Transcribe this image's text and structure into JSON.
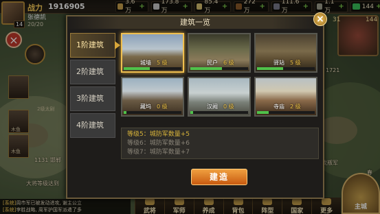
{
  "player": {
    "power_label": "战力",
    "power_value": "1916905",
    "name": "张德凯",
    "level": "14",
    "troops": "20/20"
  },
  "resources": [
    {
      "value": "3.6万",
      "icon": "gold-icon"
    },
    {
      "value": "173.8万",
      "icon": "silver-icon"
    },
    {
      "value": "85.4万",
      "icon": "food-icon"
    },
    {
      "value": "272万",
      "icon": "wood-icon"
    },
    {
      "value": "111.6万",
      "icon": "iron-icon"
    },
    {
      "value": "1.1万",
      "icon": "stone-icon"
    },
    {
      "value": "144",
      "icon": "gem-icon"
    }
  ],
  "minimap": {
    "coord_a": "31",
    "coord_b": "144"
  },
  "map_labels": [
    "1721",
    "1131 邯郸",
    "讨伐叛军",
    "大将等级达到",
    "春"
  ],
  "left_side": {
    "hero_labels": [
      "2级太尉",
      "木鱼",
      "木鱼"
    ],
    "close_label": "×"
  },
  "chat": [
    {
      "tag": "[系统]",
      "text": "周市军已被发动进攻, 谢主公立"
    },
    {
      "tag": "[系统]",
      "text": "李胜战略, 周军护国军派遣了多"
    }
  ],
  "nav": [
    "武将",
    "军师",
    "养成",
    "背包",
    "阵型",
    "国家",
    "更多"
  ],
  "main_city": "主城",
  "dialog": {
    "title": "建筑一览",
    "close": "×",
    "tabs": [
      "1阶建筑",
      "2阶建筑",
      "3阶建筑",
      "4阶建筑"
    ],
    "active_tab": 0,
    "buildings": [
      {
        "name": "城墙",
        "level": "5 级",
        "progress": 0.45
      },
      {
        "name": "民户",
        "level": "6 级",
        "progress": 0.55
      },
      {
        "name": "驿站",
        "level": "5 级",
        "progress": 0.45
      },
      {
        "name": "藏坞",
        "level": "0 级",
        "progress": 0.05
      },
      {
        "name": "汉阙",
        "level": "0 级",
        "progress": 0.05
      },
      {
        "name": "寺庙",
        "level": "2 级",
        "progress": 0.2
      }
    ],
    "info": [
      {
        "text": "等级5：城防军数量+5",
        "state": "current"
      },
      {
        "text": "等级6：城防军数量+6",
        "state": "next"
      },
      {
        "text": "等级7：城防军数量+7",
        "state": "next"
      }
    ],
    "build_button": "建造"
  },
  "colors": {
    "accent_gold": "#d8a63a",
    "progress_green": "#4fc24a",
    "level_gold": "#f2c548",
    "button_orange": "#e07a20"
  }
}
